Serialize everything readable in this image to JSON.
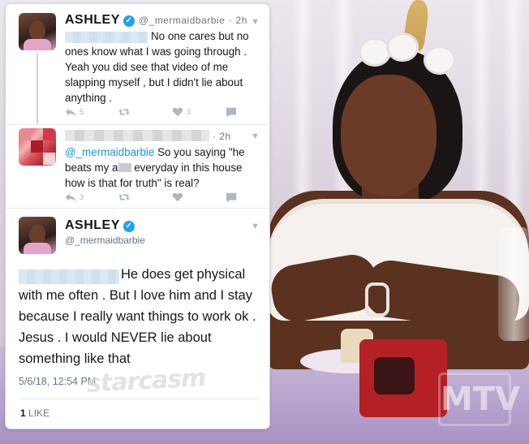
{
  "watermark": "starcasm",
  "network_logo": "MTV",
  "tweets": [
    {
      "name": "ASHLEY",
      "handle": "@_mermaidbarbie",
      "time": "· 2h",
      "text": "No one cares but no ones know what I was going through . Yeah you did see that video of me slapping myself , but I didn't lie about anything .",
      "replies": "5",
      "retweets": "",
      "likes": "3"
    },
    {
      "time": "· 2h",
      "mention": "@_mermaidbarbie",
      "text_a": " So you saying \"he beats my a",
      "text_b": " everyday in this house how is that for truth\" is real?",
      "replies": "3",
      "retweets": "",
      "likes": ""
    },
    {
      "name": "ASHLEY",
      "handle": "@_mermaidbarbie",
      "text": "He does get physical with me often . But I love him and I stay because I really want things to work ok . Jesus . I would NEVER lie about something like that",
      "datetime": "5/6/18, 12:54 PM",
      "like_count": "1",
      "like_label": "LIKE"
    }
  ],
  "icons": [
    "verified-badge-icon",
    "chevron-down-icon",
    "reply-icon",
    "retweet-icon",
    "heart-icon",
    "dm-icon"
  ],
  "colors": {
    "link": "#1b95e0",
    "verified": "#1da1f2",
    "muted": "#657786",
    "icon": "#aab8c2"
  }
}
